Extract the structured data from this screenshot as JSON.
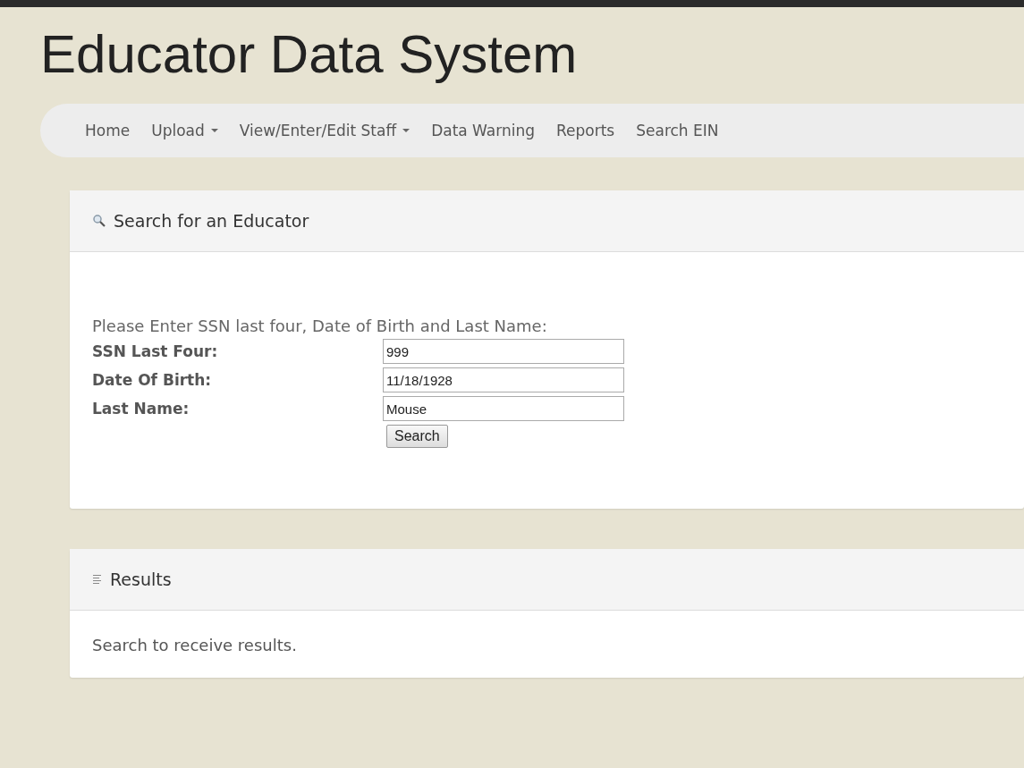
{
  "title": "Educator Data System",
  "nav": [
    {
      "label": "Home",
      "kind": "link"
    },
    {
      "label": "Upload",
      "kind": "dropdown"
    },
    {
      "label": "View/Enter/Edit Staff",
      "kind": "dropdown"
    },
    {
      "label": "Data Warning",
      "kind": "link"
    },
    {
      "label": "Reports",
      "kind": "link"
    },
    {
      "label": "Search EIN",
      "kind": "link"
    }
  ],
  "search_panel": {
    "title": "Search for an Educator",
    "prompt": "Please Enter SSN last four, Date of Birth and Last Name:",
    "fields": [
      {
        "label": "SSN Last Four:",
        "value": "999"
      },
      {
        "label": "Date Of Birth:",
        "value": "11/18/1928"
      },
      {
        "label": "Last Name:",
        "value": "Mouse"
      }
    ],
    "button": "Search"
  },
  "results_panel": {
    "title": "Results",
    "message": "Search to receive results."
  }
}
